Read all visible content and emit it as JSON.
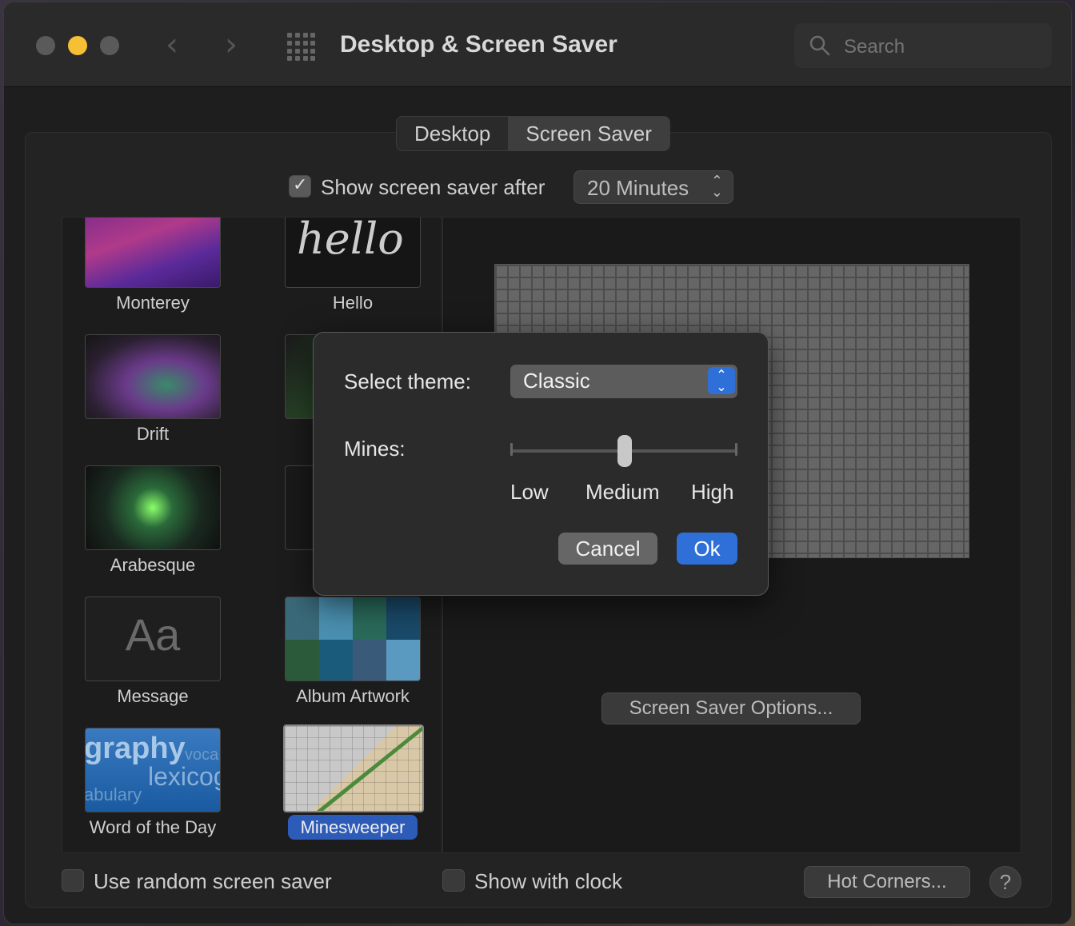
{
  "window": {
    "title": "Desktop & Screen Saver",
    "search_placeholder": "Search"
  },
  "tabs": [
    {
      "label": "Desktop",
      "active": false
    },
    {
      "label": "Screen Saver",
      "active": true
    }
  ],
  "show_after": {
    "label": "Show screen saver after",
    "checked": true,
    "value": "20 Minutes"
  },
  "savers": [
    {
      "label": "Monterey"
    },
    {
      "label": "Hello"
    },
    {
      "label": "Drift"
    },
    {
      "label": ""
    },
    {
      "label": "Arabesque"
    },
    {
      "label": ""
    },
    {
      "label": "Message",
      "thumb_text": "Aa"
    },
    {
      "label": "Album Artwork"
    },
    {
      "label": "Word of the Day",
      "thumb_text_1": "graphy",
      "thumb_text_2": "lexicog",
      "thumb_text_3": "abulary",
      "thumb_text_4": "voca"
    },
    {
      "label": "Minesweeper",
      "selected": true
    }
  ],
  "hello_text": "hello",
  "preview": {
    "options_button": "Screen Saver Options..."
  },
  "footer": {
    "random_label": "Use random screen saver",
    "random_checked": false,
    "clock_label": "Show with clock",
    "clock_checked": false,
    "hot_corners": "Hot Corners...",
    "help": "?"
  },
  "dialog": {
    "theme_label": "Select theme:",
    "theme_value": "Classic",
    "mines_label": "Mines:",
    "mines_level": 0.5,
    "levels": [
      "Low",
      "Medium",
      "High"
    ],
    "cancel": "Cancel",
    "ok": "Ok"
  },
  "colors": {
    "accent": "#2f6fd8",
    "selection": "#2d5bb8",
    "min_light": "#f5c033"
  }
}
